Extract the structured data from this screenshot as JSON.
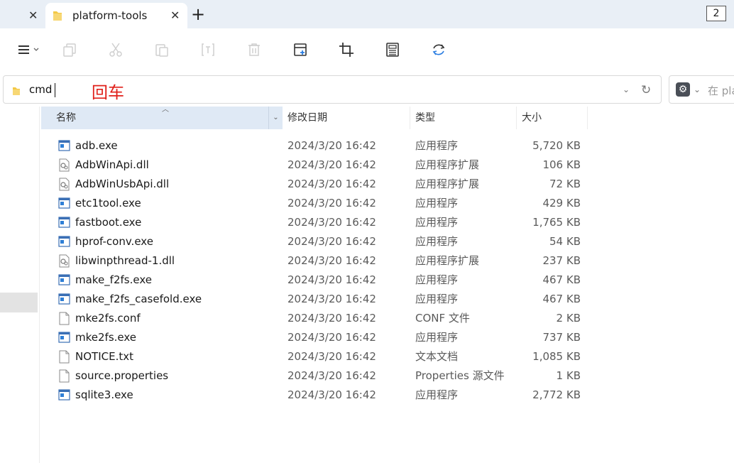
{
  "tabs": {
    "active_title": "platform-tools",
    "close_glyph": "✕",
    "add_glyph": "+",
    "window_count": "2"
  },
  "toolbar": {
    "icons": [
      "hamburger-menu-icon",
      "copy-icon",
      "cut-icon",
      "paste-icon",
      "rename-icon",
      "delete-icon",
      "new-window-icon",
      "crop-icon",
      "calculator-icon",
      "refresh-sync-icon"
    ]
  },
  "address": {
    "value": "cmd",
    "annotation": "回车"
  },
  "search": {
    "placeholder": "在 pla"
  },
  "columns": {
    "name": "名称",
    "date": "修改日期",
    "type": "类型",
    "size": "大小"
  },
  "files": [
    {
      "name": "adb.exe",
      "date": "2024/3/20 16:42",
      "type": "应用程序",
      "size": "5,720 KB",
      "icon": "exe"
    },
    {
      "name": "AdbWinApi.dll",
      "date": "2024/3/20 16:42",
      "type": "应用程序扩展",
      "size": "106 KB",
      "icon": "dll"
    },
    {
      "name": "AdbWinUsbApi.dll",
      "date": "2024/3/20 16:42",
      "type": "应用程序扩展",
      "size": "72 KB",
      "icon": "dll"
    },
    {
      "name": "etc1tool.exe",
      "date": "2024/3/20 16:42",
      "type": "应用程序",
      "size": "429 KB",
      "icon": "exe"
    },
    {
      "name": "fastboot.exe",
      "date": "2024/3/20 16:42",
      "type": "应用程序",
      "size": "1,765 KB",
      "icon": "exe"
    },
    {
      "name": "hprof-conv.exe",
      "date": "2024/3/20 16:42",
      "type": "应用程序",
      "size": "54 KB",
      "icon": "exe"
    },
    {
      "name": "libwinpthread-1.dll",
      "date": "2024/3/20 16:42",
      "type": "应用程序扩展",
      "size": "237 KB",
      "icon": "dll"
    },
    {
      "name": "make_f2fs.exe",
      "date": "2024/3/20 16:42",
      "type": "应用程序",
      "size": "467 KB",
      "icon": "exe"
    },
    {
      "name": "make_f2fs_casefold.exe",
      "date": "2024/3/20 16:42",
      "type": "应用程序",
      "size": "467 KB",
      "icon": "exe"
    },
    {
      "name": "mke2fs.conf",
      "date": "2024/3/20 16:42",
      "type": "CONF 文件",
      "size": "2 KB",
      "icon": "file"
    },
    {
      "name": "mke2fs.exe",
      "date": "2024/3/20 16:42",
      "type": "应用程序",
      "size": "737 KB",
      "icon": "exe"
    },
    {
      "name": "NOTICE.txt",
      "date": "2024/3/20 16:42",
      "type": "文本文档",
      "size": "1,085 KB",
      "icon": "file"
    },
    {
      "name": "source.properties",
      "date": "2024/3/20 16:42",
      "type": "Properties 源文件",
      "size": "1 KB",
      "icon": "file"
    },
    {
      "name": "sqlite3.exe",
      "date": "2024/3/20 16:42",
      "type": "应用程序",
      "size": "2,772 KB",
      "icon": "exe"
    }
  ]
}
